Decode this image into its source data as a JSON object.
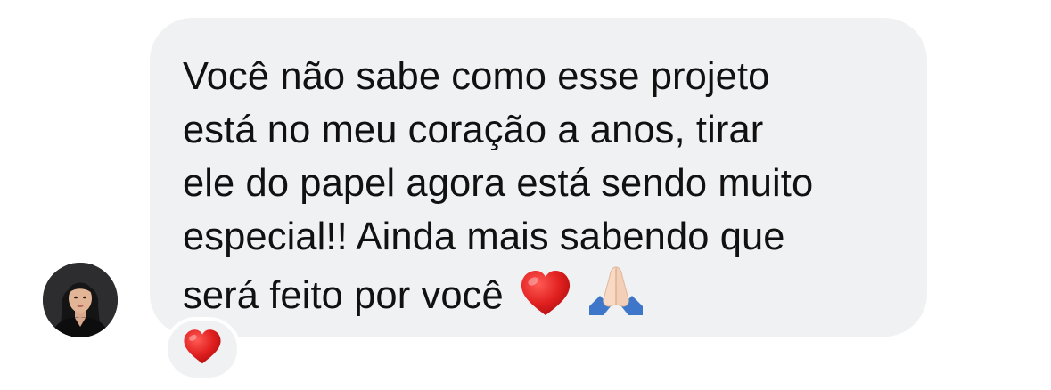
{
  "message": {
    "lines": [
      "Você não sabe como esse projeto",
      "está no meu coração a anos, tirar",
      "ele do papel agora está sendo muito",
      "especial!! Ainda mais sabendo que",
      "será feito por você"
    ],
    "trailing_emojis": [
      "heart-emoji",
      "praying-hands-emoji"
    ]
  },
  "reaction": {
    "emoji": "heart-emoji"
  },
  "sender": {
    "avatar": "profile-photo"
  },
  "colors": {
    "bubble_bg": "#f0f1f3",
    "text": "#111111",
    "heart": "#e0201f"
  }
}
